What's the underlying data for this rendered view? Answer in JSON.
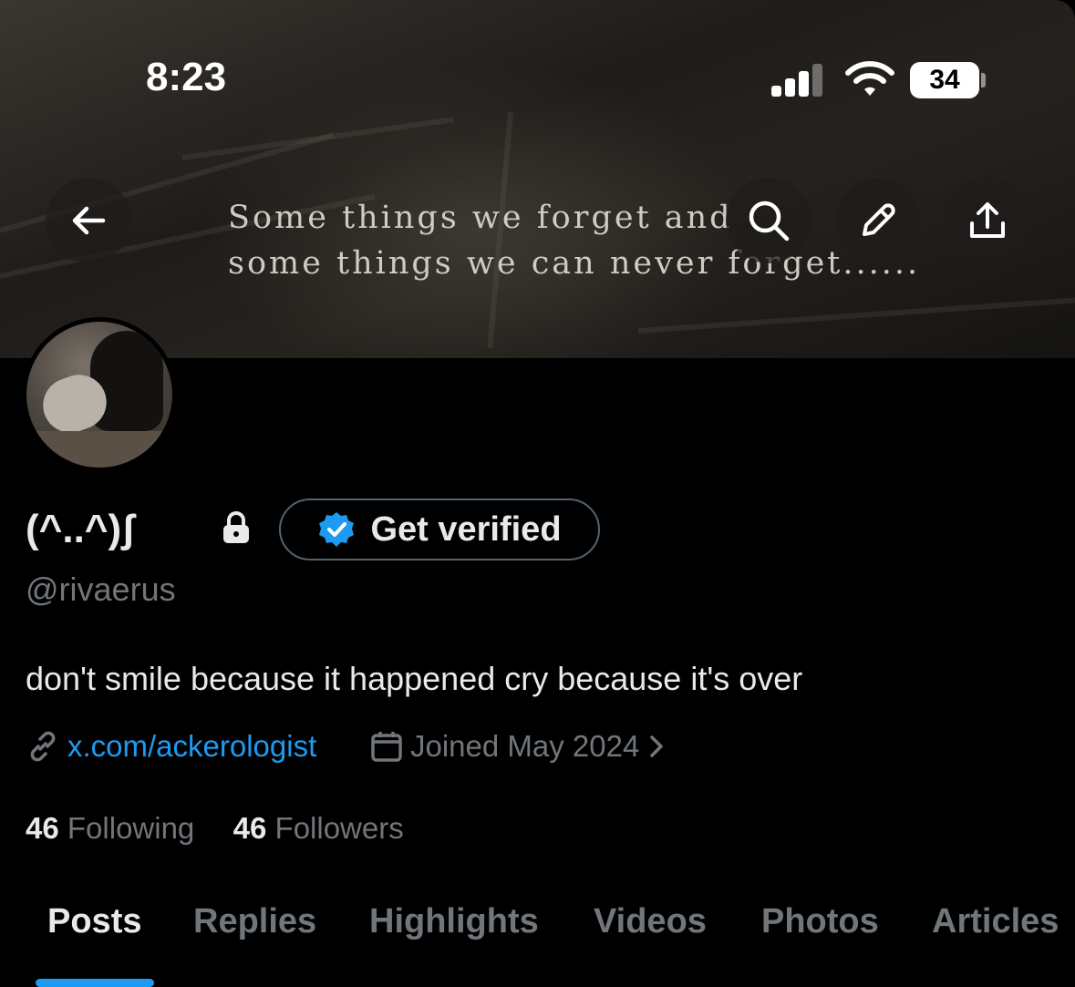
{
  "status_bar": {
    "time": "8:23",
    "battery": "34"
  },
  "banner": {
    "quote_line1": "Some things we forget and",
    "quote_line2": "some things we can never forget......"
  },
  "profile": {
    "display_name": "(^..^)ʃ",
    "get_verified_label": "Get verified",
    "handle": "@rivaerus",
    "bio": "don't smile because it happened cry because it's over",
    "link": "x.com/ackerologist",
    "joined": "Joined May 2024",
    "following_count": "46",
    "following_label": "Following",
    "followers_count": "46",
    "followers_label": "Followers"
  },
  "tabs": [
    {
      "label": "Posts",
      "active": true
    },
    {
      "label": "Replies",
      "active": false
    },
    {
      "label": "Highlights",
      "active": false
    },
    {
      "label": "Videos",
      "active": false
    },
    {
      "label": "Photos",
      "active": false
    },
    {
      "label": "Articles",
      "active": false
    }
  ],
  "colors": {
    "accent": "#1d9bf0",
    "muted": "#71767b",
    "text": "#e7e9ea",
    "verified_badge": "#1d9bf0"
  },
  "icons": [
    "back-arrow-icon",
    "search-icon",
    "pencil-icon",
    "share-icon",
    "lock-icon",
    "verified-badge-icon",
    "link-icon",
    "calendar-icon",
    "chevron-right-icon",
    "signal-icon",
    "wifi-icon",
    "battery-icon"
  ]
}
